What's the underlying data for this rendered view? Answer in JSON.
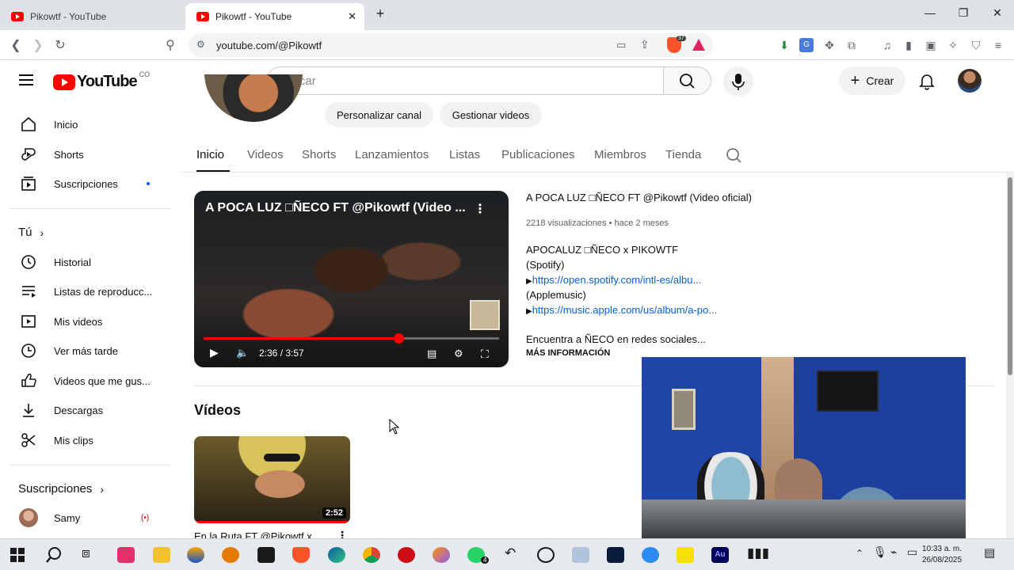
{
  "browser": {
    "tabs": [
      {
        "title": "Pikowtf - YouTube",
        "active": false
      },
      {
        "title": "Pikowtf - YouTube",
        "active": true
      }
    ],
    "new_tab_label": "+",
    "url": "youtube.com/@Pikowtf",
    "brave_badge": "37"
  },
  "header": {
    "logo_text": "YouTube",
    "country": "CO",
    "search_placeholder": "Buscar",
    "create_label": "Crear"
  },
  "sidebar": {
    "main": [
      {
        "label": "Inicio",
        "icon": "home-icon"
      },
      {
        "label": "Shorts",
        "icon": "shorts-icon"
      },
      {
        "label": "Suscripciones",
        "icon": "subscriptions-icon"
      }
    ],
    "you_header": "Tú",
    "you": [
      {
        "label": "Historial",
        "icon": "history-icon"
      },
      {
        "label": "Listas de reproducc...",
        "icon": "playlists-icon"
      },
      {
        "label": "Mis videos",
        "icon": "my-videos-icon"
      },
      {
        "label": "Ver más tarde",
        "icon": "watch-later-icon"
      },
      {
        "label": "Videos que me gus...",
        "icon": "liked-icon"
      },
      {
        "label": "Descargas",
        "icon": "download-icon"
      },
      {
        "label": "Mis clips",
        "icon": "clips-icon"
      }
    ],
    "subs_header": "Suscripciones",
    "subs": [
      {
        "label": "Samy",
        "live": true
      }
    ]
  },
  "channel": {
    "customize_label": "Personalizar canal",
    "manage_label": "Gestionar videos",
    "tabs": [
      "Inicio",
      "Videos",
      "Shorts",
      "Lanzamientos",
      "Listas",
      "Publicaciones",
      "Miembros",
      "Tienda"
    ],
    "active_tab": "Inicio"
  },
  "featured": {
    "player_title": "A POCA LUZ □ÑECO FT @Pikowtf (Video ...",
    "time_display": "2:36 / 3:57",
    "progress": 0.66,
    "title": "A POCA LUZ □ÑECO FT @Pikowtf (Video oficial)",
    "views": "2218 visualizaciones",
    "age": "hace 2 meses",
    "desc_line1": "APOCALUZ □ÑECO x PIKOWTF",
    "desc_line2": "(Spotify)",
    "desc_link1": "https://open.spotify.com/intl-es/albu...",
    "desc_line4": "(Applemusic)",
    "desc_link2": "https://music.apple.com/us/album/a-po...",
    "desc_line6": "Encuentra a ÑECO en redes sociales...",
    "more_info": "MÁS INFORMACIÓN"
  },
  "videos_section": {
    "heading": "Vídeos",
    "items": [
      {
        "title": "En la Ruta FT @Pikowtf x",
        "duration": "2:52"
      }
    ]
  },
  "taskbar": {
    "time": "10:33 a. m.",
    "date": "26/08/2025",
    "whatsapp_badge": "4"
  }
}
